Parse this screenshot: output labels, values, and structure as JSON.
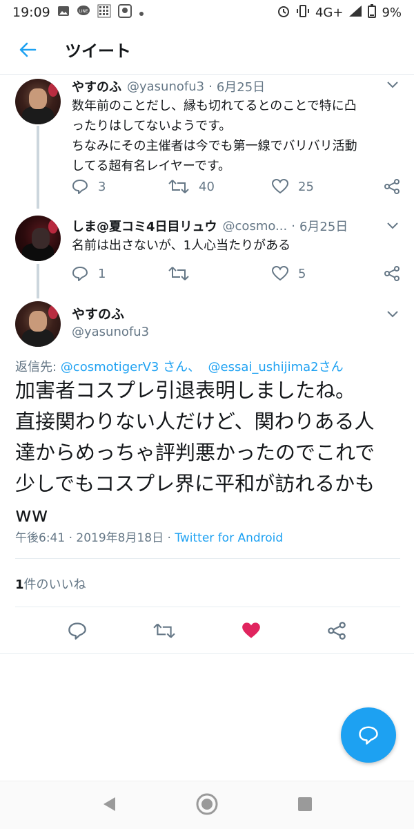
{
  "status_bar": {
    "time": "19:09",
    "network": "4G+",
    "battery": "9%"
  },
  "header": {
    "title": "ツイート"
  },
  "thread": [
    {
      "name": "やすのふ",
      "handle": "@yasunofu3",
      "date": "6月25日",
      "text": "数年前のことだし、縁も切れてるとのことで特に凸\nったりはしてないようです。\nちなみにその主催者は今でも第一線でバリバリ活動\nしてる超有名レイヤーです。",
      "replies": "3",
      "retweets": "40",
      "likes": "25"
    },
    {
      "name": "しま@夏コミ4日目リュウ",
      "handle": "@cosmo...",
      "date": "6月25日",
      "text": "名前は出さないが、1人心当たりがある",
      "replies": "1",
      "retweets": "",
      "likes": "5"
    }
  ],
  "main_tweet": {
    "name": "やすのふ",
    "handle": "@yasunofu3",
    "reply_prefix": "返信先: ",
    "mention1": "@cosmotigerV3 さん、",
    "mention2": "@essai_ushijima2さん",
    "text": "加害者コスプレ引退表明しましたね。\n直接関わりない人だけど、関わりある人\n達からめっちゃ評判悪かったのでこれで\n少しでもコスプレ界に平和が訪れるかも\nww",
    "time": "午後6:41 · 2019年8月18日 · ",
    "client": "Twitter for Android",
    "likes_count": "1",
    "likes_label": "件のいいね"
  },
  "colors": {
    "accent": "#1da1f2",
    "like": "#e0245e",
    "muted": "#657786"
  }
}
